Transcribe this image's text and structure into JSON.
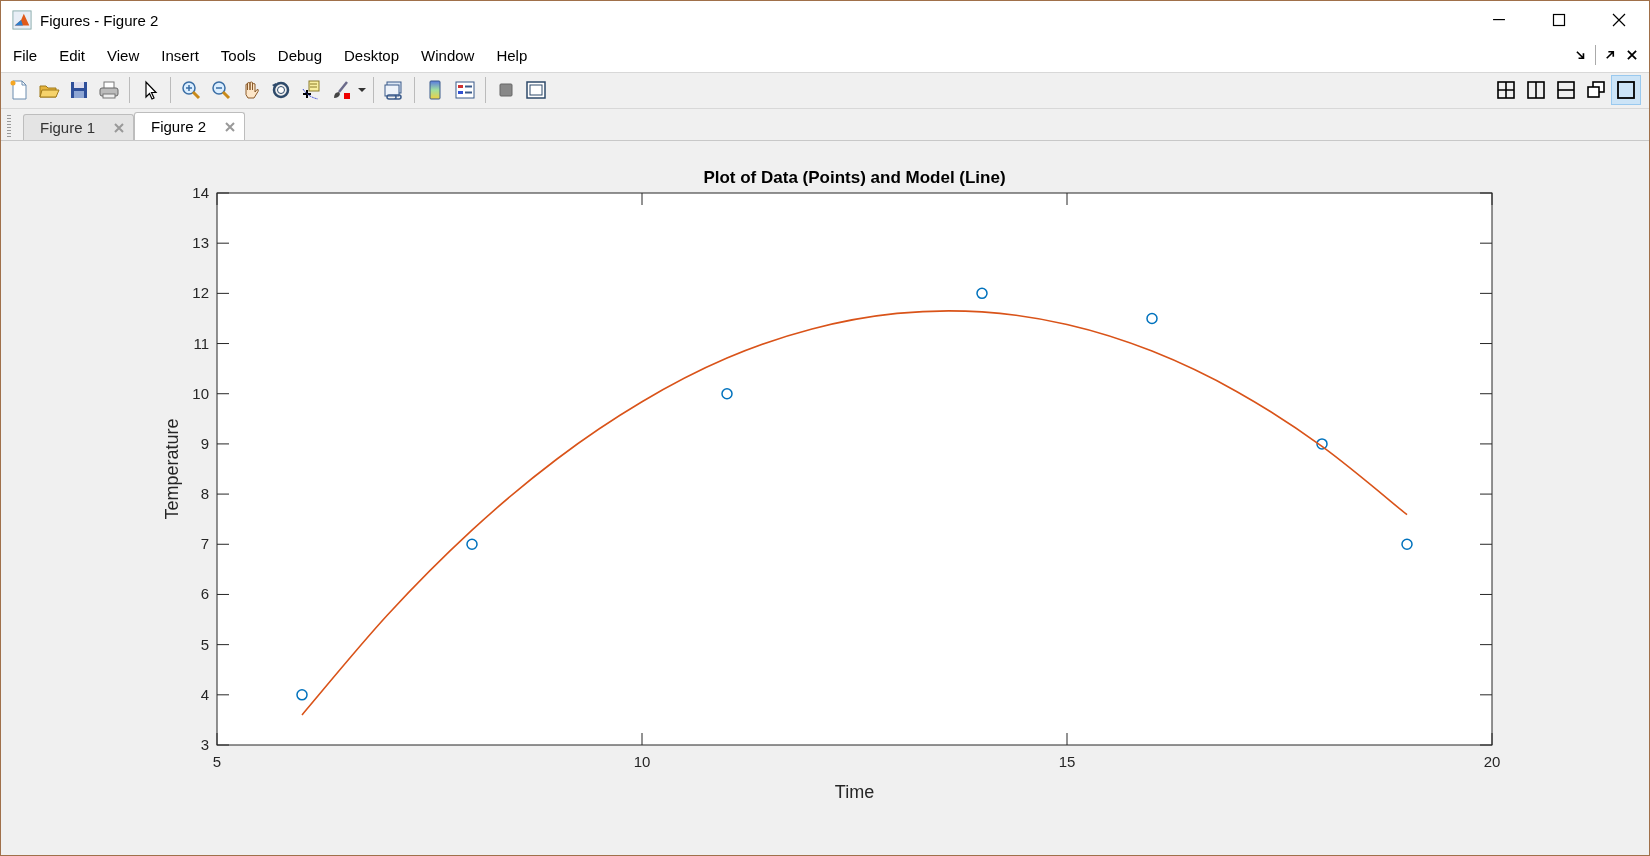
{
  "window": {
    "title": "Figures - Figure 2"
  },
  "menu": [
    "File",
    "Edit",
    "View",
    "Insert",
    "Tools",
    "Debug",
    "Desktop",
    "Window",
    "Help"
  ],
  "layout_buttons": [
    {
      "kind": "grid",
      "selected": false
    },
    {
      "kind": "columns",
      "selected": false
    },
    {
      "kind": "rows",
      "selected": false
    },
    {
      "kind": "float",
      "selected": false
    },
    {
      "kind": "single",
      "selected": true
    }
  ],
  "tabs": [
    {
      "label": "Figure 1",
      "selected": false
    },
    {
      "label": "Figure 2",
      "selected": true
    }
  ],
  "figure": {
    "chart_data": {
      "type": "scatter",
      "title": "Plot of Data (Points) and Model (Line)",
      "xlabel": "Time",
      "ylabel": "Temperature",
      "xlim": [
        5,
        20
      ],
      "ylim": [
        3,
        14
      ],
      "xticks": [
        5,
        10,
        15,
        20
      ],
      "yticks": [
        3,
        4,
        5,
        6,
        7,
        8,
        9,
        10,
        11,
        12,
        13,
        14
      ],
      "series": [
        {
          "type": "scatter",
          "color": "#0072bd",
          "x": [
            6,
            8,
            11,
            14,
            16,
            18,
            19
          ],
          "values": [
            4,
            7,
            10,
            12,
            11.5,
            9,
            7
          ]
        },
        {
          "type": "line",
          "color": "#d95319",
          "x": [
            6,
            7,
            8,
            9,
            10,
            11,
            12,
            13,
            14,
            15,
            16,
            17,
            18,
            19
          ],
          "values": [
            3.6,
            5.58,
            7.28,
            8.7,
            9.84,
            10.71,
            11.29,
            11.6,
            11.63,
            11.38,
            10.85,
            10.04,
            8.95,
            7.59
          ]
        }
      ]
    }
  }
}
